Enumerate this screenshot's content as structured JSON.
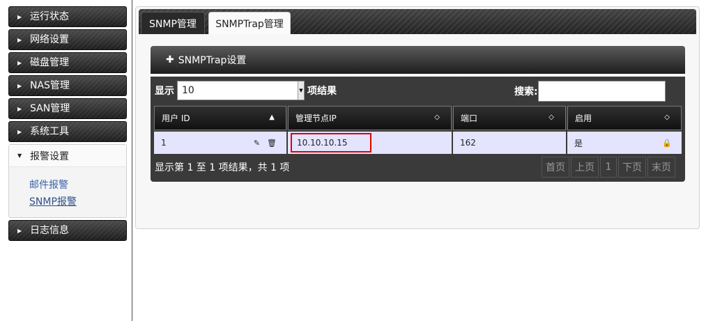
{
  "sidebar": {
    "items": [
      {
        "label": "运行状态"
      },
      {
        "label": "网络设置"
      },
      {
        "label": "磁盘管理"
      },
      {
        "label": "NAS管理"
      },
      {
        "label": "SAN管理"
      },
      {
        "label": "系统工具"
      }
    ],
    "open_group": {
      "label": "报警设置",
      "subitems": [
        {
          "label": "邮件报警"
        },
        {
          "label": "SNMP报警"
        }
      ]
    },
    "last_item": {
      "label": "日志信息"
    }
  },
  "tabs": [
    {
      "label": "SNMP管理"
    },
    {
      "label": "SNMPTrap管理"
    }
  ],
  "box": {
    "title": "SNMPTrap设置",
    "plus_icon": "plus-icon"
  },
  "controls": {
    "show_label": "显示",
    "page_size": "10",
    "results_label": "项结果",
    "search_label": "搜索:",
    "search_value": ""
  },
  "table": {
    "headers": [
      "用户 ID",
      "管理节点IP",
      "端口",
      "启用"
    ],
    "rows": [
      {
        "user_id": "1",
        "ip": "10.10.10.15",
        "port": "162",
        "enabled": "是"
      }
    ]
  },
  "footer": {
    "info": "显示第 1 至 1 项结果，共 1 项",
    "pager": [
      "首页",
      "上页",
      "1",
      "下页",
      "末页"
    ]
  },
  "colors": {
    "highlight": "#e00000",
    "row_bg": "#e4e4ff",
    "link": "#3a63a8"
  }
}
